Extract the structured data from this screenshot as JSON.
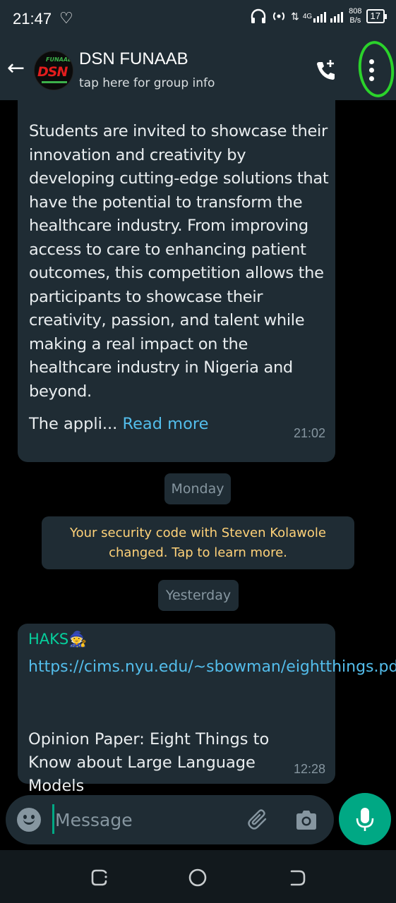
{
  "status_bar": {
    "time": "21:47",
    "network": "4G",
    "speed_value": "808",
    "speed_unit": "B/s",
    "battery": "17"
  },
  "header": {
    "group_name": "DSN FUNAAB",
    "subtitle": "tap here for group info",
    "avatar_text": "DSN",
    "avatar_top_text": "FUNAAB"
  },
  "messages": [
    {
      "text": " Students are invited to showcase their innovation and creativity by developing cutting-edge solutions that have the potential to transform the healthcare industry. From improving access to care to enhancing patient outcomes, this competition allows the participants to showcase their creativity, passion, and talent while making a real impact on the healthcare industry in Nigeria and beyond.",
      "truncated_text": "The appli...",
      "read_more": "Read more",
      "time": "21:02"
    },
    {
      "sender": "HAKS🧙",
      "link": "https://cims.nyu.edu/~sbowman/eightthings.pdf",
      "title": "Opinion Paper: Eight Things to Know about Large Language Models",
      "time": "12:28"
    }
  ],
  "date_chips": {
    "monday": "Monday",
    "yesterday": "Yesterday"
  },
  "system_message": "Your security code with Steven Kolawole changed. Tap to learn more.",
  "input": {
    "placeholder": "Message"
  },
  "colors": {
    "header_bg": "#1f2c34",
    "bubble_bg": "#1f2c34",
    "accent": "#00a884",
    "link": "#53bdeb",
    "sender": "#06cf9c",
    "system_text": "#ffd279",
    "annotation": "#2bd32b"
  }
}
